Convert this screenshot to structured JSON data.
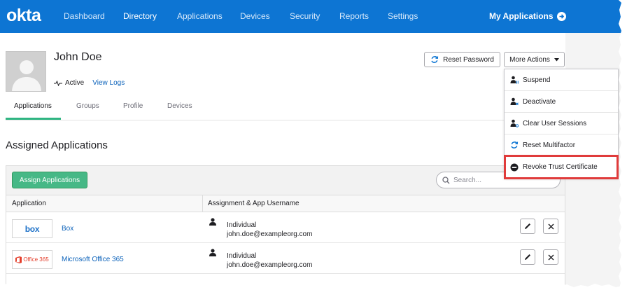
{
  "brand": {
    "logo": "okta",
    "accent": "#0d75d3",
    "green": "#46b886",
    "highlight": "#e03b3b"
  },
  "nav": {
    "items": [
      "Dashboard",
      "Directory",
      "Applications",
      "Devices",
      "Security",
      "Reports",
      "Settings"
    ],
    "active": "Directory",
    "my_apps": "My Applications"
  },
  "user": {
    "name": "John Doe",
    "status": "Active",
    "view_logs": "View Logs"
  },
  "actions": {
    "reset_password": "Reset Password",
    "more_actions": "More Actions",
    "menu": [
      "Suspend",
      "Deactivate",
      "Clear User Sessions",
      "Reset Multifactor",
      "Revoke Trust Certificate"
    ],
    "highlighted": "Revoke Trust Certificate"
  },
  "tabs": [
    "Applications",
    "Groups",
    "Profile",
    "Devices"
  ],
  "active_tab": "Applications",
  "section_title": "Assigned Applications",
  "table": {
    "assign_button": "Assign Applications",
    "search_placeholder": "Search...",
    "columns": [
      "Application",
      "Assignment & App Username"
    ],
    "rows": [
      {
        "logo": "box",
        "app": "Box",
        "assignment": "Individual",
        "username": "john.doe@exampleorg.com"
      },
      {
        "logo": "Office 365",
        "app": "Microsoft Office 365",
        "assignment": "Individual",
        "username": "john.doe@exampleorg.com"
      }
    ]
  }
}
